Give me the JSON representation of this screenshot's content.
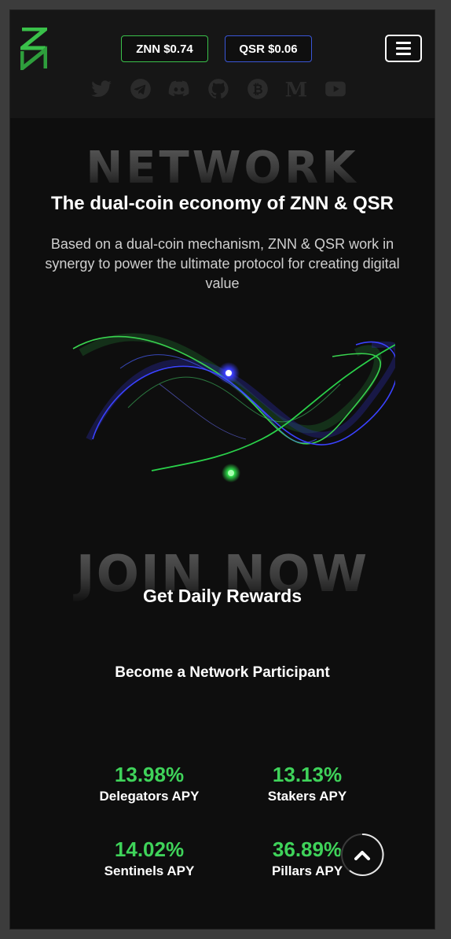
{
  "header": {
    "znn_price": "ZNN $0.74",
    "qsr_price": "QSR $0.06",
    "social_icons": [
      "twitter-icon",
      "telegram-icon",
      "discord-icon",
      "github-icon",
      "bitcoin-icon",
      "medium-icon",
      "youtube-icon"
    ]
  },
  "hero": {
    "bg_word": "NETWORK",
    "title": "The dual-coin economy of ZNN & QSR",
    "description": "Based on a dual-coin mechanism, ZNN & QSR work in synergy to power the ultimate protocol for creating digital value"
  },
  "join": {
    "bg_word": "JOIN NOW",
    "title": "Get Daily Rewards",
    "subtitle": "Become a Network Participant"
  },
  "stats": [
    {
      "value": "13.98%",
      "label": "Delegators APY"
    },
    {
      "value": "13.13%",
      "label": "Stakers APY"
    },
    {
      "value": "14.02%",
      "label": "Sentinels APY"
    },
    {
      "value": "36.89%",
      "label": "Pillars APY"
    }
  ],
  "colors": {
    "accent_green": "#3fd35a",
    "znn_border": "#3ac14a",
    "qsr_border": "#3a56d8",
    "background": "#0e0e0e"
  }
}
